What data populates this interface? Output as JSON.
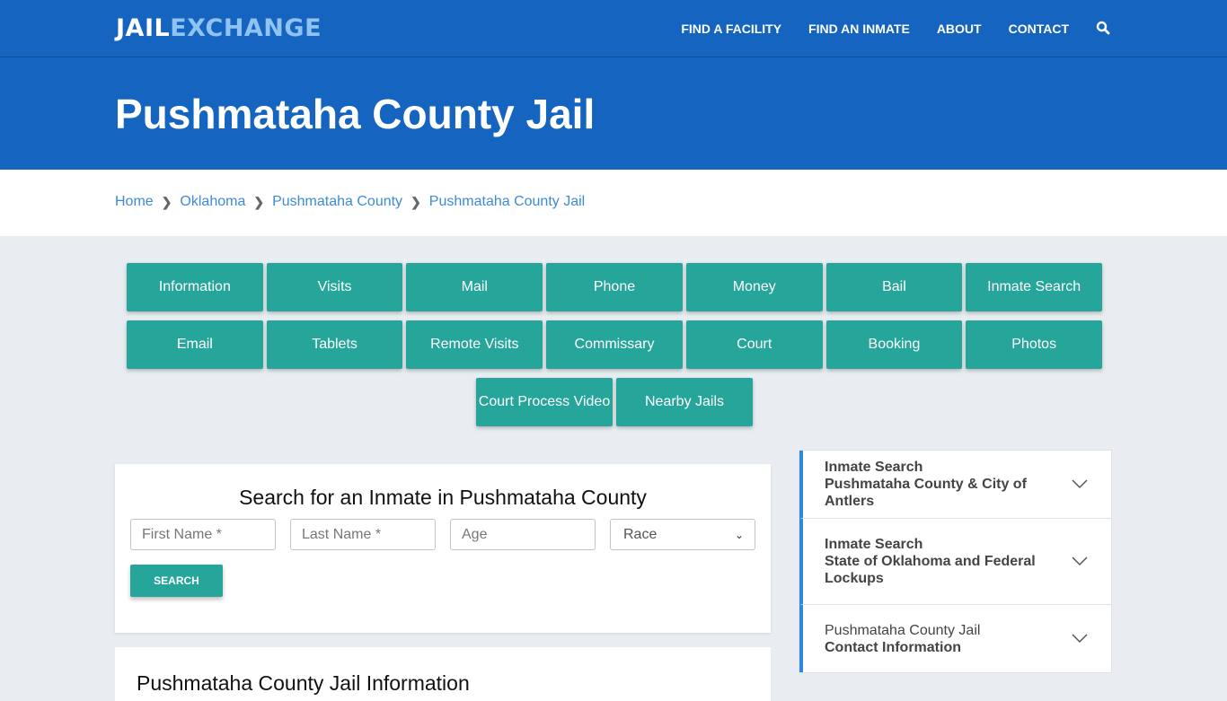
{
  "header": {
    "logo_part1": "JAIL",
    "logo_part2": "EXCHANGE",
    "nav": [
      "FIND A FACILITY",
      "FIND AN INMATE",
      "ABOUT",
      "CONTACT"
    ],
    "search_icon": "search-icon"
  },
  "hero": {
    "title": "Pushmataha County Jail"
  },
  "breadcrumb": [
    "Home",
    "Oklahoma",
    "Pushmataha County",
    "Pushmataha County Jail"
  ],
  "tiles": {
    "row1": [
      "Information",
      "Visits",
      "Mail",
      "Phone",
      "Money",
      "Bail",
      "Inmate Search"
    ],
    "row2": [
      "Email",
      "Tablets",
      "Remote Visits",
      "Commissary",
      "Court",
      "Booking",
      "Photos"
    ],
    "row3": [
      "Court Process Video",
      "Nearby Jails"
    ]
  },
  "search": {
    "title": "Search for an Inmate in Pushmataha County",
    "first_name_placeholder": "First Name *",
    "last_name_placeholder": "Last Name *",
    "age_placeholder": "Age",
    "race_selected": "Race",
    "button": "SEARCH"
  },
  "info": {
    "title": "Pushmataha County Jail Information"
  },
  "sidebar": [
    {
      "line1": "Inmate Search",
      "line2": "Pushmataha County & City of Antlers",
      "line1_bold": true
    },
    {
      "line1": "Inmate Search",
      "line2": "State of Oklahoma and Federal Lockups",
      "line1_bold": true
    },
    {
      "line1": "Pushmataha County Jail",
      "line2": "Contact Information",
      "line1_bold": false
    }
  ],
  "colors": {
    "brand_blue": "#1565c0",
    "logo_light": "#8fc3f2",
    "teal": "#26a69a",
    "link": "#3d8bd6",
    "accent_bar": "#2f89d8"
  }
}
